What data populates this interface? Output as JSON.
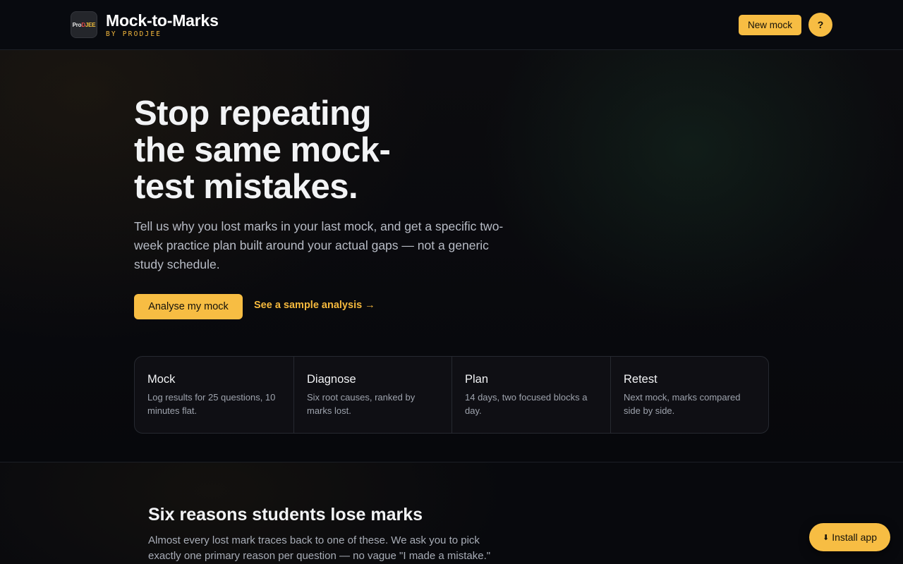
{
  "header": {
    "logo": {
      "part1": "Pro",
      "part2": "D",
      "part3": "JEE"
    },
    "title": "Mock-to-Marks",
    "subtitle": "BY PRODJEE",
    "new_mock_label": "New mock",
    "help_label": "?"
  },
  "hero": {
    "title_lines": [
      "Stop repeating",
      "the same mock-",
      "test mistakes."
    ],
    "description_lines": [
      "Tell us why you lost marks in your last mock, and get a specific two-",
      "week practice plan built around your actual gaps — not a generic",
      "study schedule."
    ],
    "primary_cta": "Analyse my mock",
    "secondary_cta": "See a sample analysis →"
  },
  "steps": [
    {
      "title": "Mock",
      "desc_lines": [
        "Log results for 25 questions, 10",
        "minutes flat."
      ]
    },
    {
      "title": "Diagnose",
      "desc_lines": [
        "Six root causes, ranked by",
        "marks lost."
      ]
    },
    {
      "title": "Plan",
      "desc_lines": [
        "14 days, two focused blocks a",
        "day."
      ]
    },
    {
      "title": "Retest",
      "desc_lines": [
        "Next mock, marks compared",
        "side by side."
      ]
    }
  ],
  "section": {
    "title": "Six reasons students lose marks",
    "desc_lines": [
      "Almost every lost mark traces back to one of these. We ask you to pick",
      "exactly one primary reason per question — no vague \"I made a mistake.\""
    ]
  },
  "install": {
    "icon": "⬇",
    "label": "Install app"
  },
  "colors": {
    "accent": "#f7bd43",
    "background": "#07080c",
    "text": "#eef0f4"
  }
}
